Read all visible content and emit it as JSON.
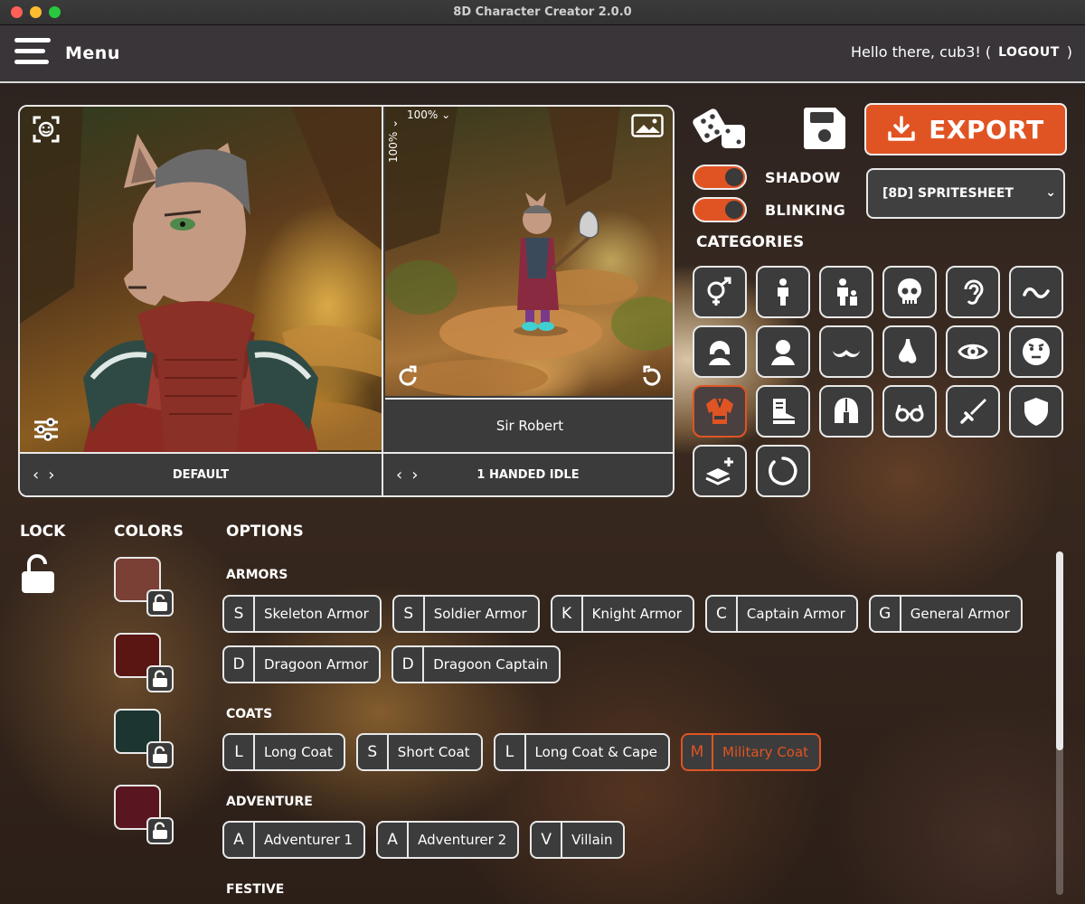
{
  "window": {
    "title": "8D Character Creator 2.0.0"
  },
  "header": {
    "menu_label": "Menu",
    "greeting": "Hello there, cub3! (",
    "logout_label": "LOGOUT",
    "close_paren": ")"
  },
  "preview": {
    "zoom_label": "100% ⌄",
    "zoom_label_vertical": "100% ⌄",
    "character_name": "Sir Robert",
    "portrait_pose": "DEFAULT",
    "scene_pose": "1 HANDED IDLE"
  },
  "tools": {
    "export_label": "EXPORT",
    "shadow_label": "SHADOW",
    "blinking_label": "BLINKING",
    "shadow_on": true,
    "blinking_on": true,
    "format_value": "[8D] SPRITESHEET",
    "categories_title": "CATEGORIES"
  },
  "categories": [
    {
      "icon": "gender-icon"
    },
    {
      "icon": "body-icon"
    },
    {
      "icon": "body-type-icon"
    },
    {
      "icon": "skull-icon"
    },
    {
      "icon": "ear-icon"
    },
    {
      "icon": "tail-icon"
    },
    {
      "icon": "hair-icon"
    },
    {
      "icon": "head-icon"
    },
    {
      "icon": "mustache-icon"
    },
    {
      "icon": "nose-icon"
    },
    {
      "icon": "eye-icon"
    },
    {
      "icon": "expression-icon"
    },
    {
      "icon": "torso-icon",
      "active": true
    },
    {
      "icon": "boot-icon"
    },
    {
      "icon": "helmet-icon"
    },
    {
      "icon": "glasses-icon"
    },
    {
      "icon": "sword-icon"
    },
    {
      "icon": "shield-icon"
    },
    {
      "icon": "layers-add-icon"
    },
    {
      "icon": "loading-ring-icon"
    }
  ],
  "bottom": {
    "lock_title": "LOCK",
    "colors_title": "COLORS",
    "options_title": "OPTIONS",
    "colors": [
      "#7a3f35",
      "#5a1612",
      "#1c3530",
      "#5a1620"
    ]
  },
  "option_groups": [
    {
      "title": "ARMORS",
      "rows": [
        [
          {
            "letter": "S",
            "label": "Skeleton Armor"
          },
          {
            "letter": "S",
            "label": "Soldier Armor"
          },
          {
            "letter": "K",
            "label": "Knight Armor"
          },
          {
            "letter": "C",
            "label": "Captain Armor"
          },
          {
            "letter": "G",
            "label": "General Armor"
          }
        ],
        [
          {
            "letter": "D",
            "label": "Dragoon Armor"
          },
          {
            "letter": "D",
            "label": "Dragoon Captain"
          }
        ]
      ]
    },
    {
      "title": "COATS",
      "rows": [
        [
          {
            "letter": "L",
            "label": "Long Coat"
          },
          {
            "letter": "S",
            "label": "Short Coat"
          },
          {
            "letter": "L",
            "label": "Long Coat & Cape"
          },
          {
            "letter": "M",
            "label": "Military Coat",
            "selected": true
          }
        ]
      ]
    },
    {
      "title": "ADVENTURE",
      "rows": [
        [
          {
            "letter": "A",
            "label": "Adventurer 1"
          },
          {
            "letter": "A",
            "label": "Adventurer 2"
          },
          {
            "letter": "V",
            "label": "Villain"
          }
        ]
      ]
    },
    {
      "title": "FESTIVE",
      "rows": []
    }
  ],
  "theme": {
    "accent": "#e05424",
    "panel": "#3c3c3c",
    "border": "#e8e8e8"
  }
}
